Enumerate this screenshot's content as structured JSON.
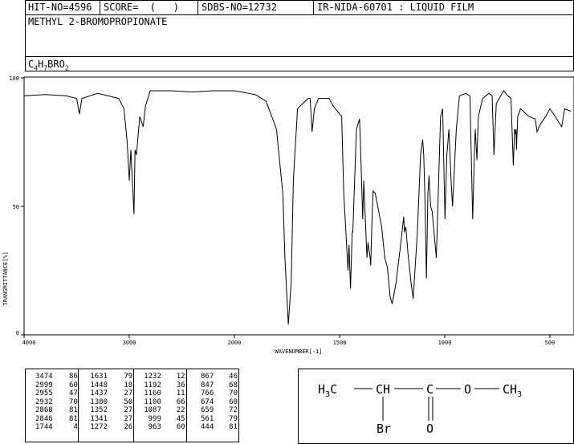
{
  "header": {
    "hit_no": "HIT-NO=4596",
    "score": "SCORE=  (   )",
    "sdbs_no": "SDBS-NO=12732",
    "ir_nida": "IR-NIDA-60701 : LIQUID FILM"
  },
  "compound_name": "METHYL 2-BROMOPROPIONATE",
  "formula": {
    "c": "C",
    "c_n": "4",
    "h": "H",
    "h_n": "7",
    "rest": "BRO",
    "o_n": "2"
  },
  "structure": {
    "h3c": "H3C",
    "ch": "CH",
    "c": "C",
    "o": "O",
    "ch3": "CH3",
    "br": "Br",
    "o_dbl": "O",
    "h3c_sub": "3",
    "ch3_sub": "3"
  },
  "chart_data": {
    "type": "line",
    "xlabel": "WAVENUMBER[-1]",
    "ylabel": "TRANSMITTANCE[%]",
    "xlim": [
      4000,
      400
    ],
    "ylim": [
      0,
      100
    ],
    "x_ticks": [
      "4000",
      "3000",
      "2000",
      "1500",
      "1000",
      "500"
    ],
    "y_ticks": [
      "100",
      "50",
      "0"
    ],
    "series": [
      {
        "x": [
          4000,
          3800,
          3600,
          3500,
          3474,
          3450,
          3300,
          3100,
          3050,
          3020,
          2999,
          2985,
          2955,
          2945,
          2932,
          2900,
          2868,
          2846,
          2800,
          2600,
          2400,
          2200,
          2000,
          1900,
          1850,
          1800,
          1770,
          1760,
          1744,
          1730,
          1720,
          1700,
          1650,
          1640,
          1631,
          1620,
          1600,
          1550,
          1530,
          1520,
          1490,
          1480,
          1460,
          1455,
          1448,
          1440,
          1437,
          1420,
          1405,
          1400,
          1390,
          1385,
          1380,
          1370,
          1365,
          1355,
          1352,
          1347,
          1341,
          1330,
          1300,
          1285,
          1272,
          1260,
          1250,
          1232,
          1210,
          1195,
          1192,
          1185,
          1175,
          1160,
          1150,
          1130,
          1115,
          1105,
          1100,
          1095,
          1087,
          1080,
          1075,
          1067,
          1060,
          1040,
          1020,
          1010,
          999,
          990,
          980,
          970,
          963,
          945,
          930,
          900,
          880,
          867,
          860,
          855,
          847,
          840,
          820,
          790,
          775,
          766,
          755,
          720,
          700,
          685,
          674,
          668,
          663,
          661,
          659,
          653,
          640,
          600,
          570,
          561,
          545,
          520,
          500,
          475,
          460,
          444,
          430,
          400
        ],
        "y": [
          93,
          93.5,
          93,
          92,
          86,
          92,
          94,
          92,
          88,
          75,
          60,
          72,
          47,
          72,
          70,
          85,
          81,
          89,
          95,
          95,
          94.5,
          95,
          95,
          93.5,
          91,
          80,
          55,
          30,
          4,
          20,
          60,
          88,
          92,
          92,
          79,
          88,
          92,
          92,
          89,
          88,
          85,
          55,
          25,
          35,
          18,
          40,
          40,
          80,
          84,
          72,
          45,
          60,
          50,
          30,
          36,
          30,
          27,
          42,
          56,
          55,
          42,
          30,
          26,
          15,
          12,
          20,
          35,
          46,
          40,
          42,
          32,
          20,
          14,
          40,
          70,
          76,
          70,
          56,
          22,
          55,
          62,
          50,
          48,
          30,
          85,
          88,
          45,
          70,
          80,
          60,
          50,
          80,
          93,
          94,
          93,
          45,
          68,
          80,
          68,
          85,
          92,
          94,
          93,
          70,
          90,
          95,
          93,
          92,
          66,
          80,
          78,
          80,
          72,
          85,
          88,
          85,
          84,
          79,
          82,
          85,
          88,
          85,
          83,
          81,
          88,
          87
        ]
      }
    ],
    "peaks": [
      [
        "3474",
        "86",
        "1631",
        "79",
        "1232",
        "12",
        "867",
        "46"
      ],
      [
        "2999",
        "60",
        "1448",
        "18",
        "1192",
        "36",
        "847",
        "68"
      ],
      [
        "2955",
        "47",
        "1437",
        "27",
        "1160",
        "11",
        "766",
        "70"
      ],
      [
        "2932",
        "70",
        "1380",
        "50",
        "1100",
        "66",
        "674",
        "60"
      ],
      [
        "2868",
        "81",
        "1352",
        "27",
        "1087",
        "22",
        "659",
        "72"
      ],
      [
        "2846",
        "81",
        "1341",
        "27",
        "999",
        "45",
        "561",
        "79"
      ],
      [
        "1744",
        "4",
        "1272",
        "26",
        "963",
        "60",
        "444",
        "81"
      ]
    ]
  }
}
